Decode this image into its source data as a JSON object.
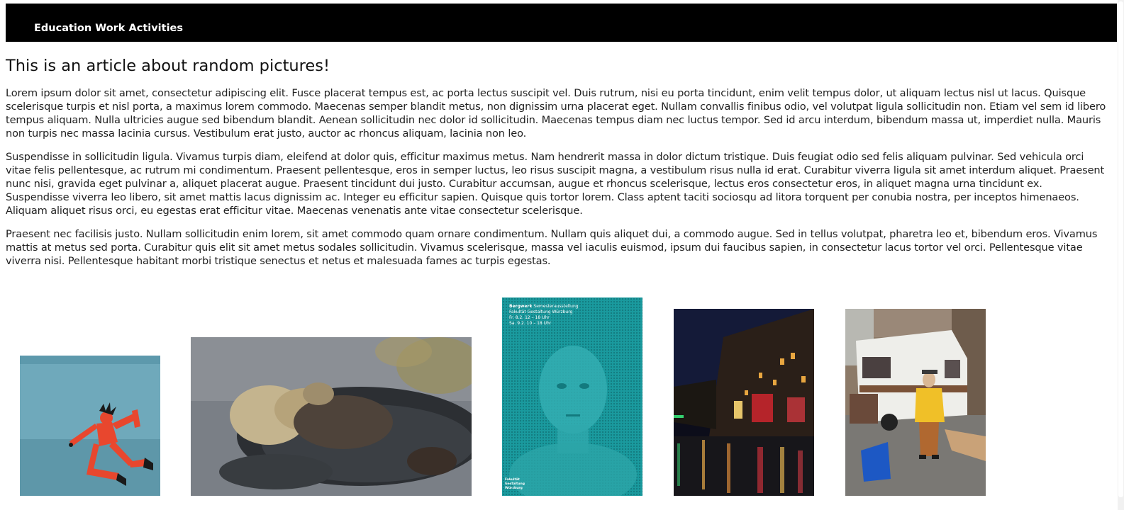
{
  "nav": {
    "link_label": "Education Work Activities"
  },
  "article": {
    "title": "This is an article about random pictures!",
    "paragraphs": [
      "Lorem ipsum dolor sit amet, consectetur adipiscing elit. Fusce placerat tempus est, ac porta lectus suscipit vel. Duis rutrum, nisi eu porta tincidunt, enim velit tempus dolor, ut aliquam lectus nisl ut lacus. Quisque scelerisque turpis et nisl porta, a maximus lorem commodo. Maecenas semper blandit metus, non dignissim urna placerat eget. Nullam convallis finibus odio, vel volutpat ligula sollicitudin non. Etiam vel sem id libero tempus aliquam. Nulla ultricies augue sed bibendum blandit. Aenean sollicitudin nec dolor id sollicitudin. Maecenas tempus diam nec luctus tempor. Sed id arcu interdum, bibendum massa ut, imperdiet nulla. Mauris non turpis nec massa lacinia cursus. Vestibulum erat justo, auctor ac rhoncus aliquam, lacinia non leo.",
      "Suspendisse in sollicitudin ligula. Vivamus turpis diam, eleifend at dolor quis, efficitur maximus metus. Nam hendrerit massa in dolor dictum tristique. Duis feugiat odio sed felis aliquam pulvinar. Sed vehicula orci vitae felis pellentesque, ac rutrum mi condimentum. Praesent pellentesque, eros in semper luctus, leo risus suscipit magna, a vestibulum risus nulla id erat. Curabitur viverra ligula sit amet interdum aliquet. Praesent nunc nisi, gravida eget pulvinar a, aliquet placerat augue. Praesent tincidunt dui justo. Curabitur accumsan, augue et rhoncus scelerisque, lectus eros consectetur eros, in aliquet magna urna tincidunt ex. Suspendisse viverra leo libero, sit amet mattis lacus dignissim ac. Integer eu efficitur sapien. Quisque quis tortor lorem. Class aptent taciti sociosqu ad litora torquent per conubia nostra, per inceptos himenaeos. Aliquam aliquet risus orci, eu egestas erat efficitur vitae. Maecenas venenatis ante vitae consectetur scelerisque.",
      "Praesent nec facilisis justo. Nullam sollicitudin enim lorem, sit amet commodo quam ornare condimentum. Nullam quis aliquet dui, a commodo augue. Sed in tellus volutpat, pharetra leo et, bibendum eros. Vivamus mattis at metus sed porta. Curabitur quis elit sit amet metus sodales sollicitudin. Vivamus scelerisque, massa vel iaculis euismod, ipsum dui faucibus sapien, in consectetur lacus tortor vel orci. Pellentesque vitae viverra nisi. Pellentesque habitant morbi tristique senectus et netus et malesuada fames ac turpis egestas."
    ]
  },
  "poster": {
    "line1_bold": "Bergwerk",
    "line1_rest": "Semesterausstellung",
    "line2": "Fakultät Gestaltung Würzburg",
    "line3": "Fr. 8.2. 12 – 18 Uhr",
    "line4": "Sa. 9.2. 10 – 18 Uhr",
    "footer1": "Fakultät",
    "footer2": "Gestaltung",
    "footer3": "Würzburg"
  },
  "colors": {
    "nav_bg": "#000000",
    "nav_text": "#ffffff",
    "poster_teal": "#1a9a9e"
  }
}
